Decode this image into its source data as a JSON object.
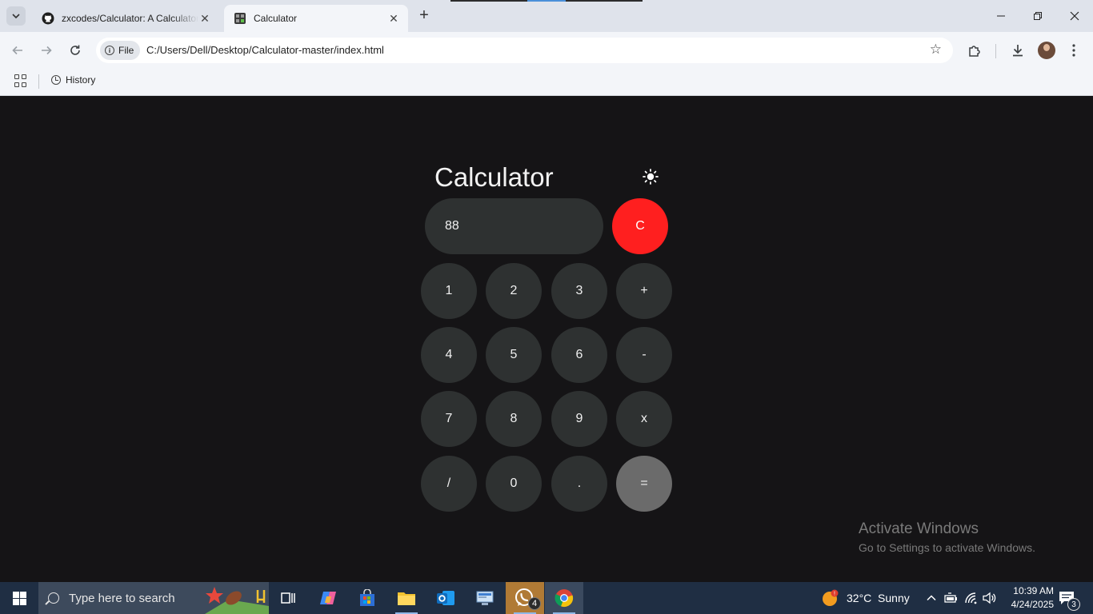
{
  "browser": {
    "tabs": [
      {
        "title": "zxcodes/Calculator: A Calculator",
        "active": false
      },
      {
        "title": "Calculator",
        "active": true
      }
    ],
    "address": {
      "chip_label": "File",
      "url": "C:/Users/Dell/Desktop/Calculator-master/index.html"
    },
    "bookmarks": {
      "history_label": "History"
    }
  },
  "calculator": {
    "title": "Calculator",
    "display_value": "88",
    "clear_label": "C",
    "keys": [
      [
        "1",
        "2",
        "3",
        "+"
      ],
      [
        "4",
        "5",
        "6",
        "-"
      ],
      [
        "7",
        "8",
        "9",
        "x"
      ],
      [
        "/",
        "0",
        ".",
        "="
      ]
    ],
    "colors": {
      "background": "#151416",
      "key": "#2e3131",
      "clear": "#ff1f1f",
      "equals": "#6b6b6b"
    }
  },
  "watermark": {
    "line1": "Activate Windows",
    "line2": "Go to Settings to activate Windows."
  },
  "taskbar": {
    "search_placeholder": "Type here to search",
    "whatsapp_badge": "4",
    "weather": "32°C  Sunny",
    "time": "10:39 AM",
    "date": "4/24/2025",
    "notification_count": "3"
  }
}
